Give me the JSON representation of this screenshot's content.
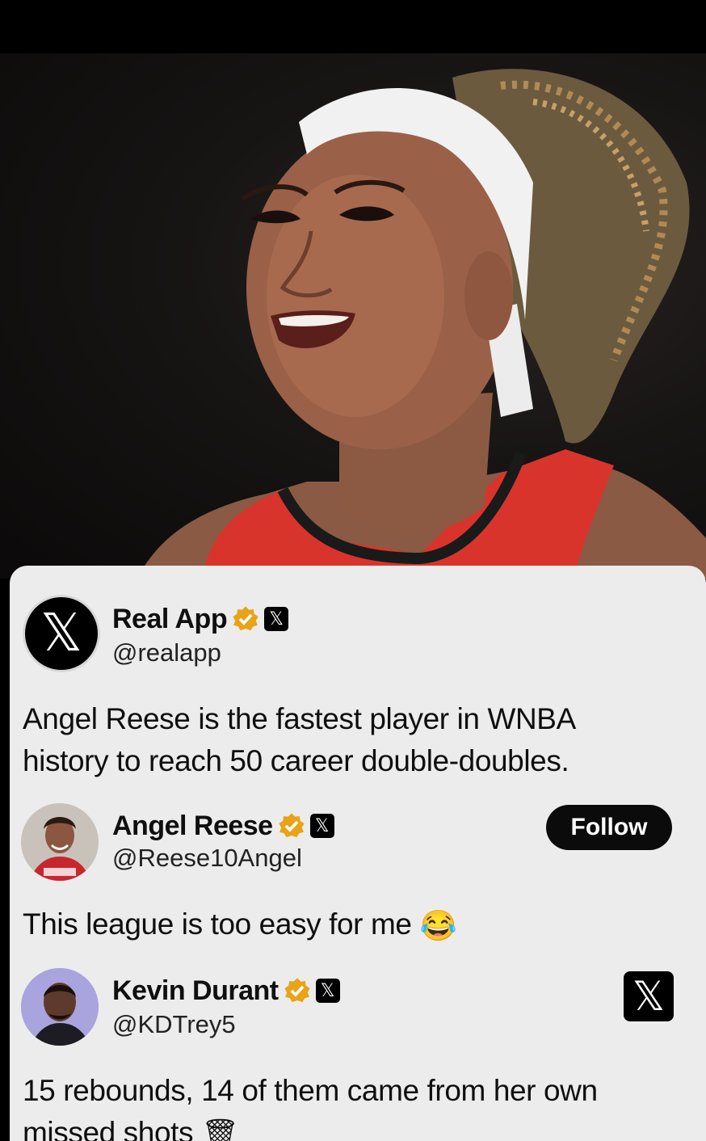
{
  "photo": {
    "subject": "Basketball player smiling, wearing white headband and red jersey"
  },
  "tweets": [
    {
      "name": "Real App",
      "handle": "@realapp",
      "avatar_icon": "x-logo-icon",
      "text_lines": [
        "Angel Reese is the fastest player in WNBA",
        "history to reach 50 career double-doubles."
      ],
      "verified_color": "#e8a317"
    },
    {
      "name": "Angel Reese",
      "handle": "@Reese10Angel",
      "text": "This league is too easy for me",
      "emoji": "😂",
      "follow_label": "Follow"
    },
    {
      "name": "Kevin Durant",
      "handle": "@KDTrey5",
      "text_lines": [
        "15 rebounds, 14 of them came from her own",
        "missed shots"
      ],
      "emoji": "🗑"
    }
  ],
  "x_glyph": "𝕏",
  "colors": {
    "card_bg": "#ececec",
    "verified": "#e8a317",
    "jersey": "#d9342b"
  }
}
